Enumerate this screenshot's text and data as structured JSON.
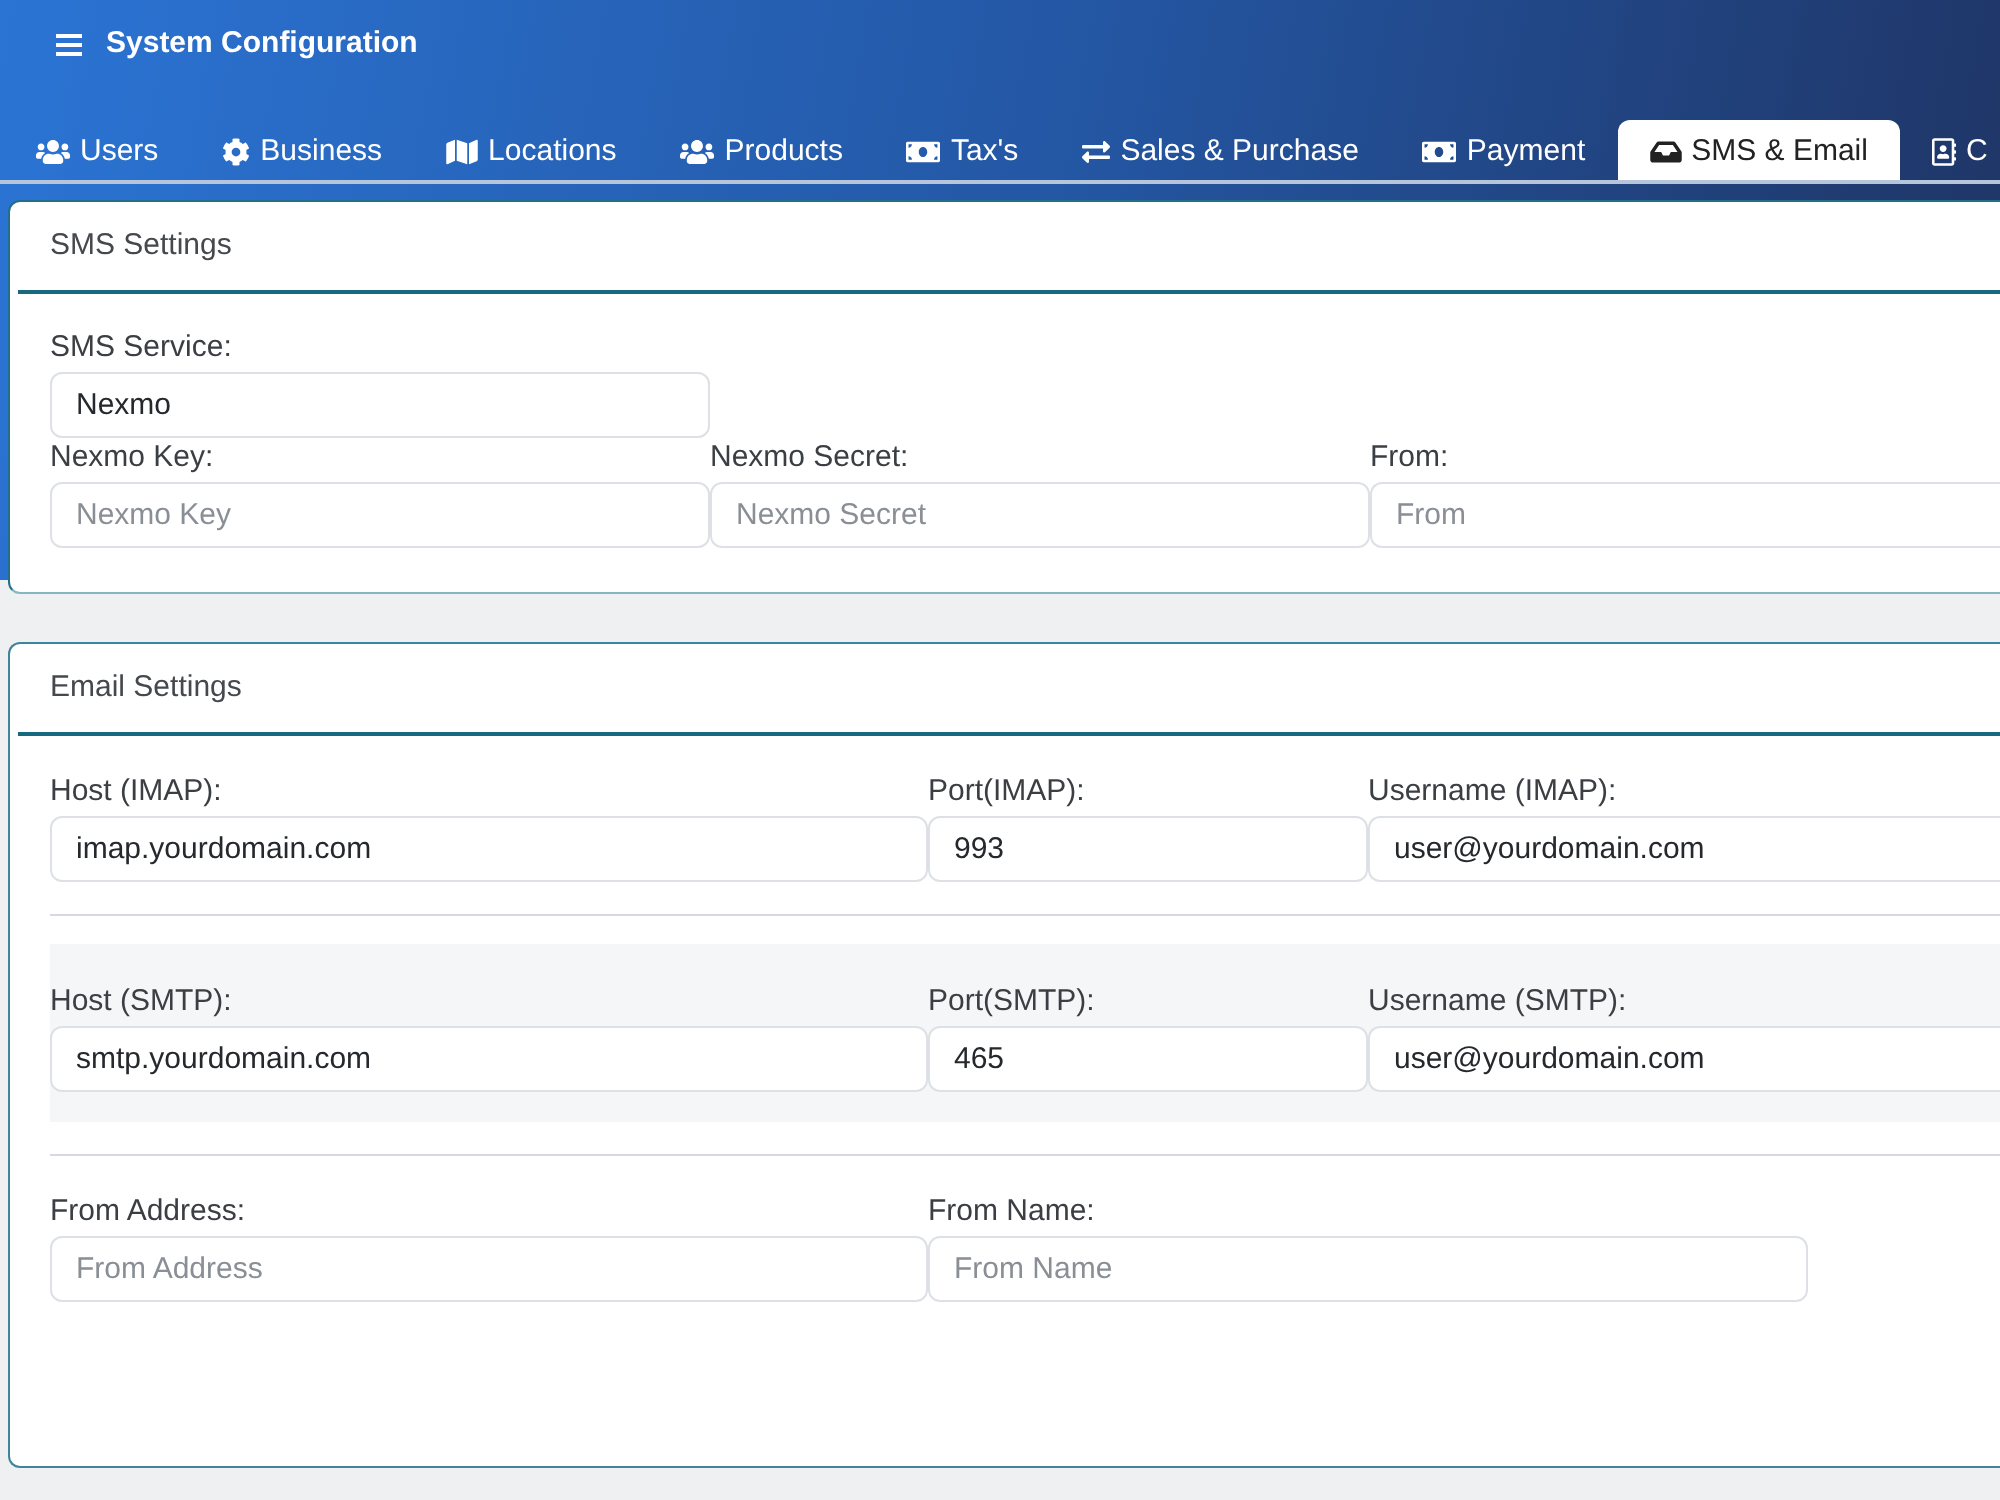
{
  "header": {
    "title": "System Configuration"
  },
  "tabs": [
    {
      "label": "Users",
      "selected": false
    },
    {
      "label": "Business",
      "selected": false
    },
    {
      "label": "Locations",
      "selected": false
    },
    {
      "label": "Products",
      "selected": false
    },
    {
      "label": "Tax's",
      "selected": false
    },
    {
      "label": "Sales & Purchase",
      "selected": false
    },
    {
      "label": "Payment",
      "selected": false
    },
    {
      "label": "SMS & Email",
      "selected": true
    },
    {
      "label": "C",
      "selected": false
    }
  ],
  "sms_settings": {
    "title": "SMS Settings",
    "rows": [
      [
        {
          "label": "SMS Service:",
          "value": "Nexmo"
        }
      ],
      [
        {
          "label": "Nexmo Key:",
          "placeholder": "Nexmo Key"
        },
        {
          "label": "Nexmo Secret:",
          "placeholder": "Nexmo Secret"
        },
        {
          "label": "From:",
          "placeholder": "From"
        }
      ]
    ]
  },
  "email_settings": {
    "title": "Email Settings",
    "groups": [
      {
        "highlighted": false,
        "fields": [
          {
            "label": "Host (IMAP):",
            "value": "imap.yourdomain.com"
          },
          {
            "label": "Port(IMAP):",
            "value": "993"
          },
          {
            "label": "Username (IMAP):",
            "value": "user@yourdomain.com"
          }
        ]
      },
      {
        "highlighted": true,
        "fields": [
          {
            "label": "Host (SMTP):",
            "value": "smtp.yourdomain.com"
          },
          {
            "label": "Port(SMTP):",
            "value": "465"
          },
          {
            "label": "Username (SMTP):",
            "value": "user@yourdomain.com"
          }
        ]
      },
      {
        "highlighted": false,
        "fields": [
          {
            "label": "From Address:",
            "placeholder": "From Address"
          },
          {
            "label": "From Name:",
            "placeholder": "From Name"
          }
        ]
      }
    ]
  }
}
